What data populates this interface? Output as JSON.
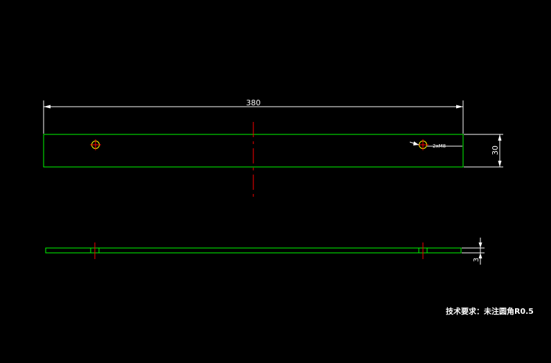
{
  "colors": {
    "background": "#000000",
    "outline": "#00ff00",
    "dimension": "#ffffff",
    "centerline": "#ff0000",
    "hole": "#ffff00"
  },
  "dimensions": {
    "length": "380",
    "width": "30",
    "thickness": "3",
    "hole_callout": "2xM8"
  },
  "note": {
    "text": "技术要求：未注圆角R0.5"
  }
}
